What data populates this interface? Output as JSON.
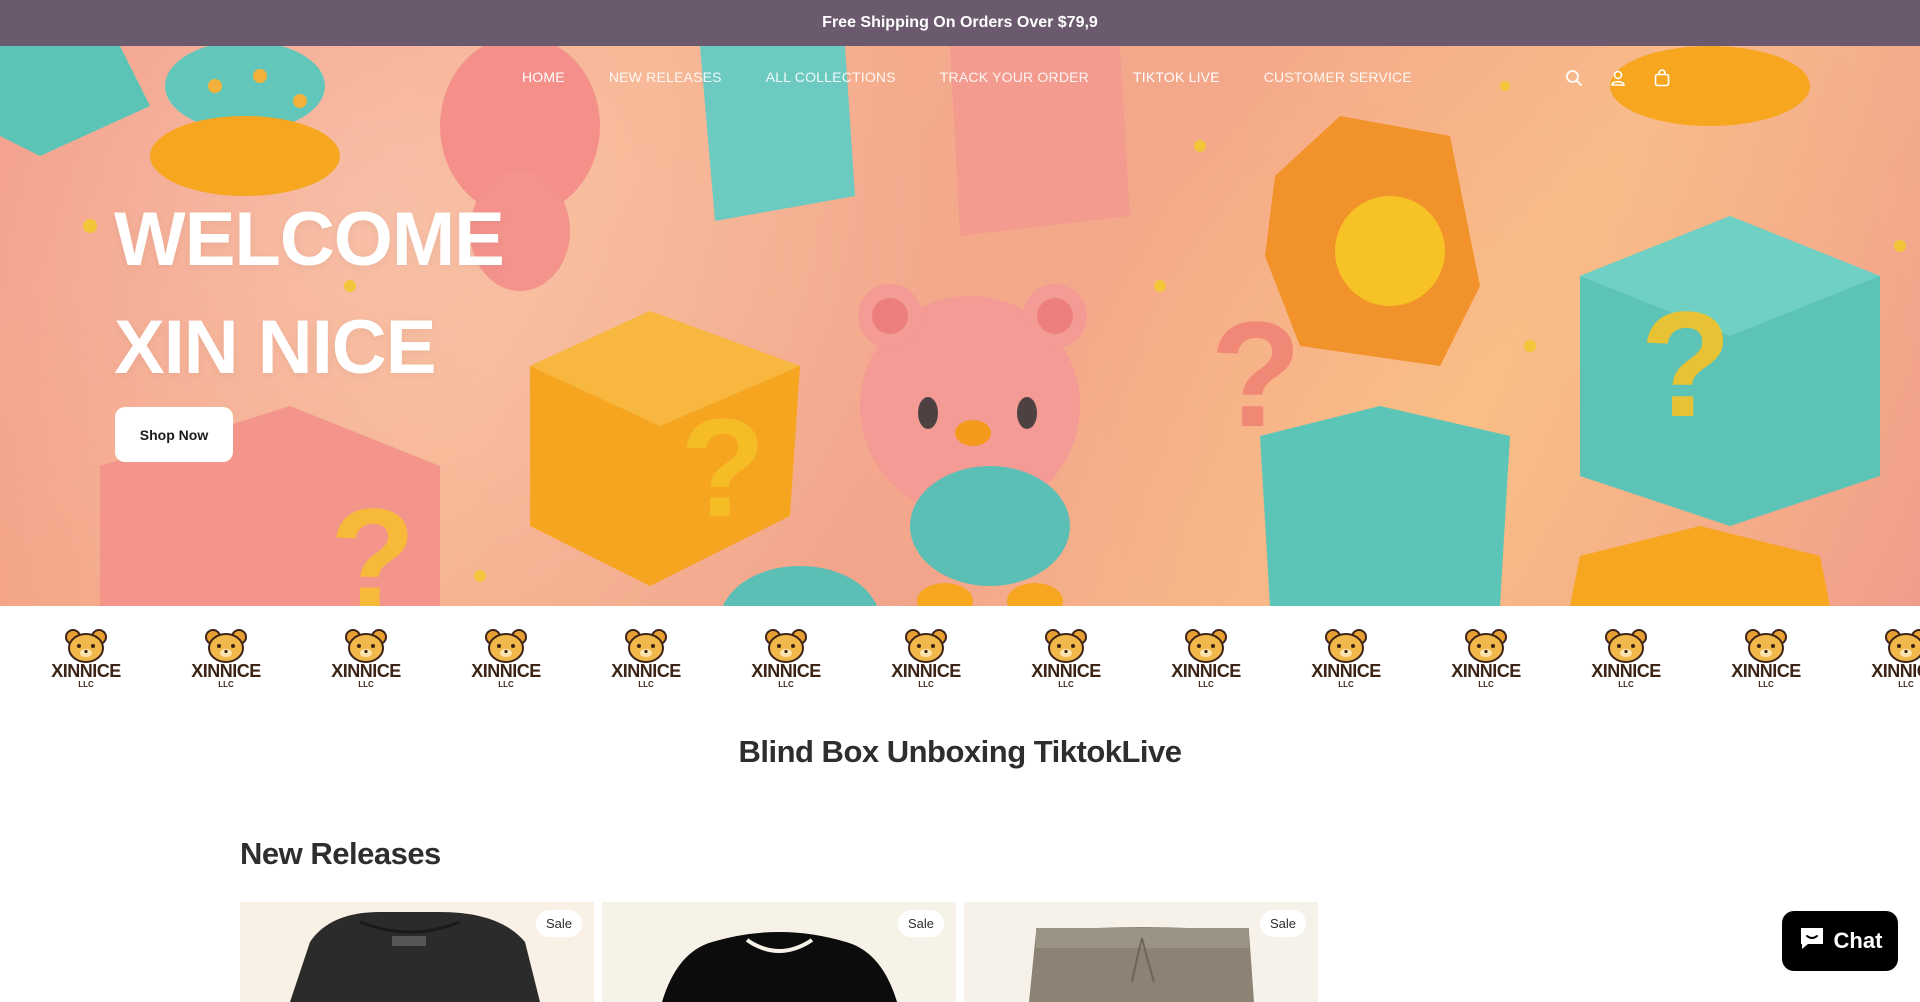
{
  "announcement": {
    "text": "Free Shipping On Orders Over $79,9"
  },
  "nav": {
    "items": [
      {
        "label": "HOME"
      },
      {
        "label": "NEW RELEASES"
      },
      {
        "label": "ALL COLLECTIONS"
      },
      {
        "label": "TRACK YOUR ORDER"
      },
      {
        "label": "TIKTOK LIVE"
      },
      {
        "label": "CUSTOMER SERVICE"
      }
    ],
    "icons": [
      "search-icon",
      "account-icon",
      "cart-icon"
    ]
  },
  "hero": {
    "line1": "WELCOME",
    "line2": "XIN NICE",
    "button": "Shop Now"
  },
  "logo_strip": {
    "brand": "XINNICE",
    "sub": "LLC"
  },
  "tiktok_section": {
    "title": "Blind Box Unboxing TiktokLive"
  },
  "new_releases": {
    "title": "New Releases",
    "products": [
      {
        "badge": "Sale"
      },
      {
        "badge": "Sale"
      },
      {
        "badge": "Sale"
      }
    ]
  },
  "chat": {
    "label": "Chat"
  },
  "colors": {
    "announcement_bg": "#6b5a6e",
    "brand_text": "#3b2415",
    "chat_bg": "#000000"
  }
}
